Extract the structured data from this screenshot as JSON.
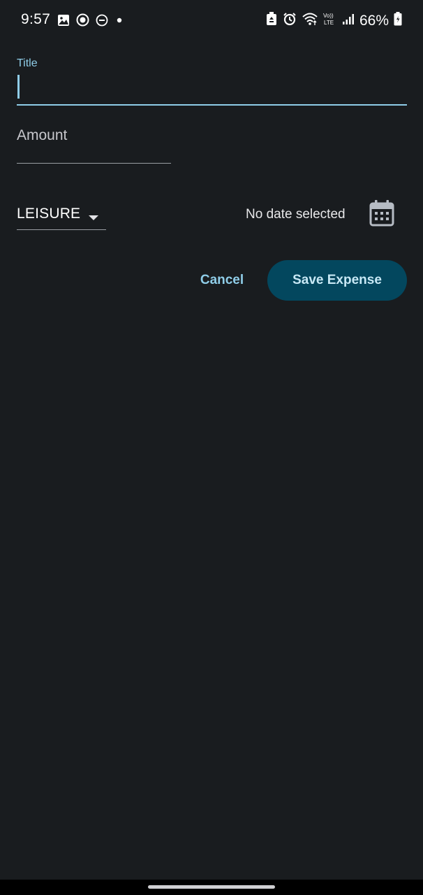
{
  "status_bar": {
    "time": "9:57",
    "battery_percent": "66%",
    "left_icons": [
      "image-icon",
      "record-icon",
      "dnd-icon",
      "dot-icon"
    ],
    "right_icons": [
      "recycle-icon",
      "alarm-icon",
      "wifi-icon",
      "volte-icon",
      "signal-icon",
      "battery-icon"
    ]
  },
  "form": {
    "title_label": "Title",
    "title_value": "",
    "amount_placeholder": "Amount",
    "category_value": "LEISURE",
    "date_text": "No date selected",
    "calendar_icon": "calendar-icon"
  },
  "actions": {
    "cancel_label": "Cancel",
    "save_label": "Save Expense"
  },
  "colors": {
    "background": "#191c1f",
    "accent": "#8fcde8",
    "primary_button": "#03475e"
  }
}
